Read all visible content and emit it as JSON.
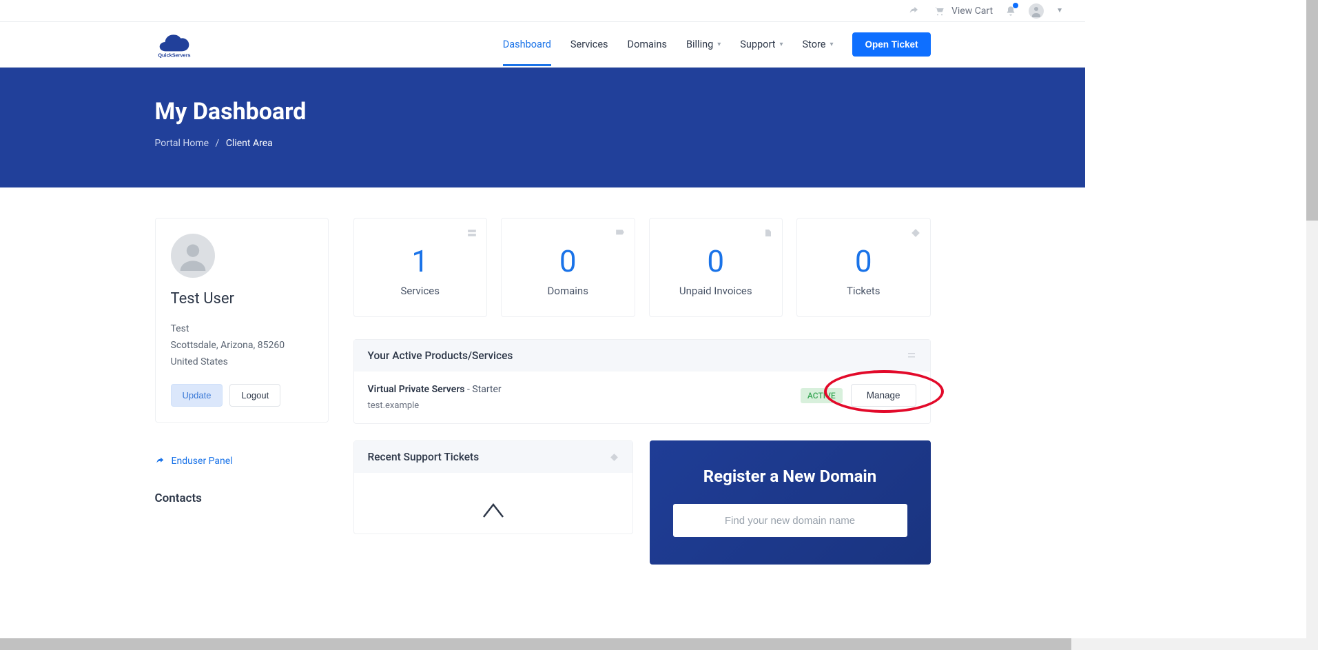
{
  "util": {
    "view_cart": "View Cart"
  },
  "nav": {
    "dashboard": "Dashboard",
    "services": "Services",
    "domains": "Domains",
    "billing": "Billing",
    "support": "Support",
    "store": "Store",
    "open_ticket": "Open Ticket",
    "logo": "QuickServers"
  },
  "hero": {
    "title": "My Dashboard",
    "breadcrumb_home": "Portal Home",
    "breadcrumb_current": "Client Area"
  },
  "user": {
    "name": "Test User",
    "company": "Test",
    "location": "Scottsdale, Arizona, 85260",
    "country": "United States",
    "update": "Update",
    "logout": "Logout"
  },
  "sidebar": {
    "enduser_panel": "Enduser Panel",
    "contacts_head": "Contacts"
  },
  "stats": {
    "services_count": "1",
    "services_label": "Services",
    "domains_count": "0",
    "domains_label": "Domains",
    "invoices_count": "0",
    "invoices_label": "Unpaid Invoices",
    "tickets_count": "0",
    "tickets_label": "Tickets"
  },
  "active_products": {
    "head": "Your Active Products/Services",
    "item": {
      "category": "Virtual Private Servers",
      "plan_sep": " - ",
      "plan": "Starter",
      "domain": "test.example",
      "status": "ACTIVE",
      "manage": "Manage"
    }
  },
  "recent_tickets": {
    "head": "Recent Support Tickets"
  },
  "register": {
    "head": "Register a New Domain",
    "placeholder": "Find your new domain name"
  }
}
